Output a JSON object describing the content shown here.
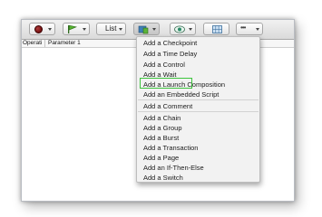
{
  "toolbar": {
    "list_label": "List",
    "more_label": "•••"
  },
  "columns": {
    "operation": "Operati",
    "parameter": "Parameter 1"
  },
  "menu": {
    "group1": [
      "Add a Checkpoint",
      "Add a Time Delay",
      "Add a Control",
      "Add a Wait",
      "Add a Launch Composition",
      "Add an Embedded Script"
    ],
    "group2": [
      "Add a Comment"
    ],
    "group3": [
      "Add a Chain",
      "Add a Group",
      "Add a Burst",
      "Add a Transaction",
      "Add a Page",
      "Add an If-Then-Else",
      "Add a Switch"
    ]
  },
  "highlight_color": "#3cc43c"
}
